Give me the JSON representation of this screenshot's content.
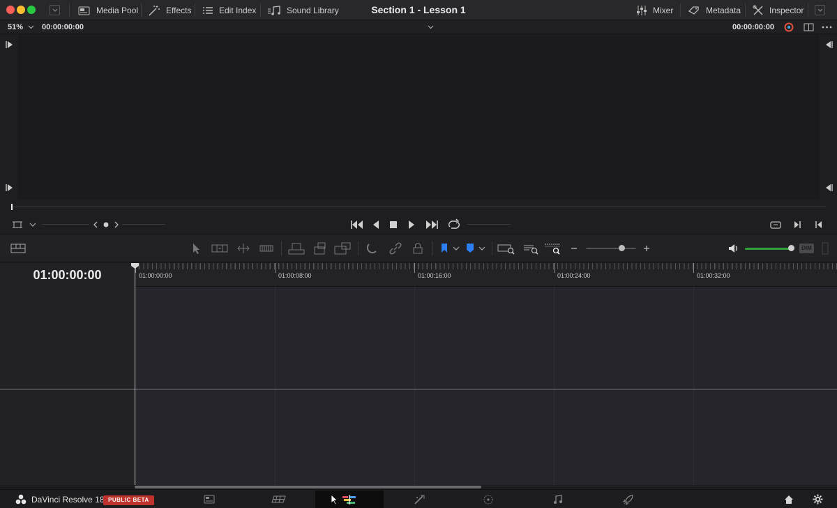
{
  "window": {
    "project_title": "Section 1 - Lesson 1"
  },
  "toolbar": {
    "left": [
      {
        "label": "Media Pool",
        "icon": "media-pool-icon"
      },
      {
        "label": "Effects",
        "icon": "effects-wand-icon"
      },
      {
        "label": "Edit Index",
        "icon": "list-icon"
      },
      {
        "label": "Sound Library",
        "icon": "music-note-icon"
      }
    ],
    "right": [
      {
        "label": "Mixer",
        "icon": "mixer-sliders-icon"
      },
      {
        "label": "Metadata",
        "icon": "metadata-tag-icon"
      },
      {
        "label": "Inspector",
        "icon": "inspector-tools-icon"
      }
    ]
  },
  "viewer": {
    "zoom": "51%",
    "source_timecode": "00:00:00:00",
    "record_timecode": "00:00:00:00"
  },
  "timeline": {
    "current_timecode": "01:00:00:00",
    "ruler_labels": [
      "01:00:00:00",
      "01:00:08:00",
      "01:00:16:00",
      "01:00:24:00",
      "01:00:32:00"
    ],
    "dim_label": "DIM",
    "volume_level": 1.0
  },
  "pagebar": {
    "app_name": "DaVinci Resolve 18",
    "badge": "PUBLIC BETA",
    "pages": [
      "media",
      "cut",
      "edit",
      "fusion",
      "color",
      "fairlight",
      "deliver"
    ],
    "active_page": "edit"
  },
  "colors": {
    "accent_blue": "#2d7df6",
    "volume_green": "#2fa23a",
    "beta_red": "#c0322e"
  }
}
